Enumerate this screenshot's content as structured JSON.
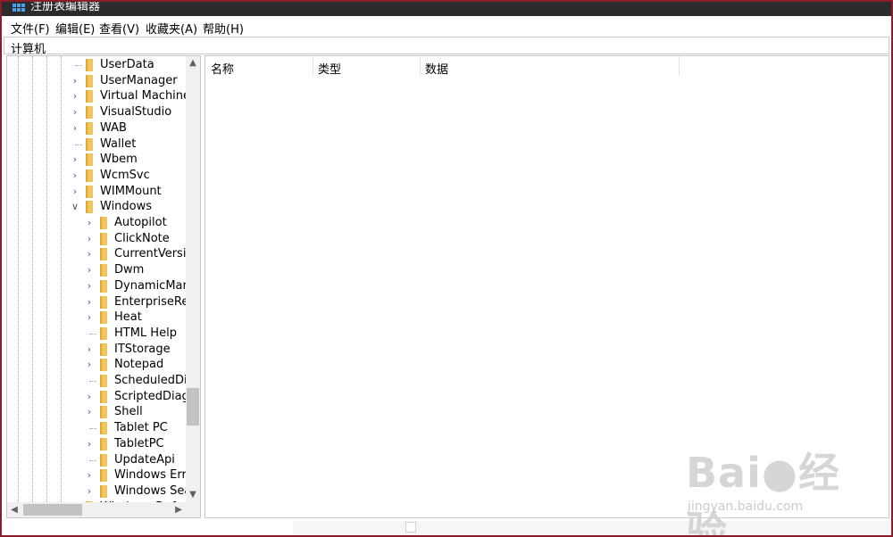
{
  "window": {
    "title": "注册表编辑器"
  },
  "menu": [
    "文件(F)",
    "编辑(E)",
    "查看(V)",
    "收藏夹(A)",
    "帮助(H)"
  ],
  "address": {
    "path": "计算机"
  },
  "tree": {
    "items": [
      {
        "label": "UserData",
        "expand": "none",
        "depth": 0
      },
      {
        "label": "UserManager",
        "expand": "collapsed",
        "depth": 0
      },
      {
        "label": "Virtual Machine",
        "expand": "collapsed",
        "depth": 0
      },
      {
        "label": "VisualStudio",
        "expand": "collapsed",
        "depth": 0
      },
      {
        "label": "WAB",
        "expand": "collapsed",
        "depth": 0
      },
      {
        "label": "Wallet",
        "expand": "none",
        "depth": 0
      },
      {
        "label": "Wbem",
        "expand": "collapsed",
        "depth": 0
      },
      {
        "label": "WcmSvc",
        "expand": "collapsed",
        "depth": 0
      },
      {
        "label": "WIMMount",
        "expand": "collapsed",
        "depth": 0
      },
      {
        "label": "Windows",
        "expand": "expanded",
        "depth": 0
      },
      {
        "label": "Autopilot",
        "expand": "collapsed",
        "depth": 1
      },
      {
        "label": "ClickNote",
        "expand": "collapsed",
        "depth": 1
      },
      {
        "label": "CurrentVersic",
        "expand": "collapsed",
        "depth": 1
      },
      {
        "label": "Dwm",
        "expand": "collapsed",
        "depth": 1
      },
      {
        "label": "DynamicMana",
        "expand": "collapsed",
        "depth": 1
      },
      {
        "label": "EnterpriseRes",
        "expand": "collapsed",
        "depth": 1
      },
      {
        "label": "Heat",
        "expand": "collapsed",
        "depth": 1
      },
      {
        "label": "HTML Help",
        "expand": "none",
        "depth": 1
      },
      {
        "label": "ITStorage",
        "expand": "collapsed",
        "depth": 1
      },
      {
        "label": "Notepad",
        "expand": "collapsed",
        "depth": 1
      },
      {
        "label": "ScheduledDia",
        "expand": "none",
        "depth": 1
      },
      {
        "label": "ScriptedDiagi",
        "expand": "collapsed",
        "depth": 1
      },
      {
        "label": "Shell",
        "expand": "collapsed",
        "depth": 1
      },
      {
        "label": "Tablet PC",
        "expand": "none",
        "depth": 1
      },
      {
        "label": "TabletPC",
        "expand": "collapsed",
        "depth": 1
      },
      {
        "label": "UpdateApi",
        "expand": "none",
        "depth": 1
      },
      {
        "label": "Windows Erro",
        "expand": "collapsed",
        "depth": 1
      },
      {
        "label": "Windows Sea",
        "expand": "collapsed",
        "depth": 1
      },
      {
        "label": "Windows Defe",
        "expand": "none",
        "depth": 0
      }
    ]
  },
  "list": {
    "columns": [
      "名称",
      "类型",
      "数据"
    ]
  },
  "watermark": {
    "sub": "jingyan.baidu.com"
  }
}
